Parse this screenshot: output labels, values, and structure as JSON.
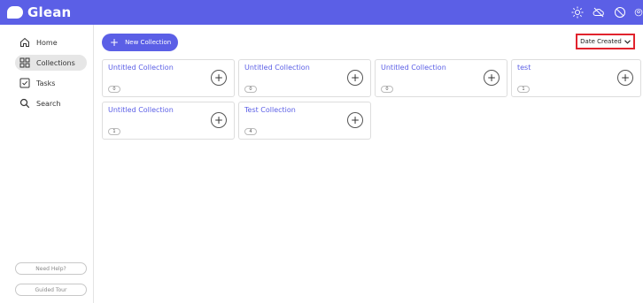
{
  "brand": {
    "name": "Glean"
  },
  "topbar": {
    "icons": [
      "sun-icon",
      "cloud-off-icon",
      "blocked-icon",
      "profile-icon"
    ]
  },
  "sidebar": {
    "items": [
      {
        "label": "Home",
        "icon": "home-icon"
      },
      {
        "label": "Collections",
        "icon": "collections-icon",
        "active": true
      },
      {
        "label": "Tasks",
        "icon": "tasks-icon"
      },
      {
        "label": "Search",
        "icon": "search-icon"
      }
    ],
    "help_label": "Need Help?",
    "tour_label": "Guided Tour"
  },
  "toolbar": {
    "new_label": "New Collection",
    "sort_label": "Date Created"
  },
  "collections": [
    {
      "title": "Untitled Collection",
      "count": "0"
    },
    {
      "title": "Untitled Collection",
      "count": "0"
    },
    {
      "title": "Untitled Collection",
      "count": "0"
    },
    {
      "title": "test",
      "count": "1"
    },
    {
      "title": "Untitled Collection",
      "count": "1"
    },
    {
      "title": "Test Collection",
      "count": "4"
    }
  ],
  "colors": {
    "accent": "#5b5fe6",
    "highlight": "#e1232d"
  }
}
